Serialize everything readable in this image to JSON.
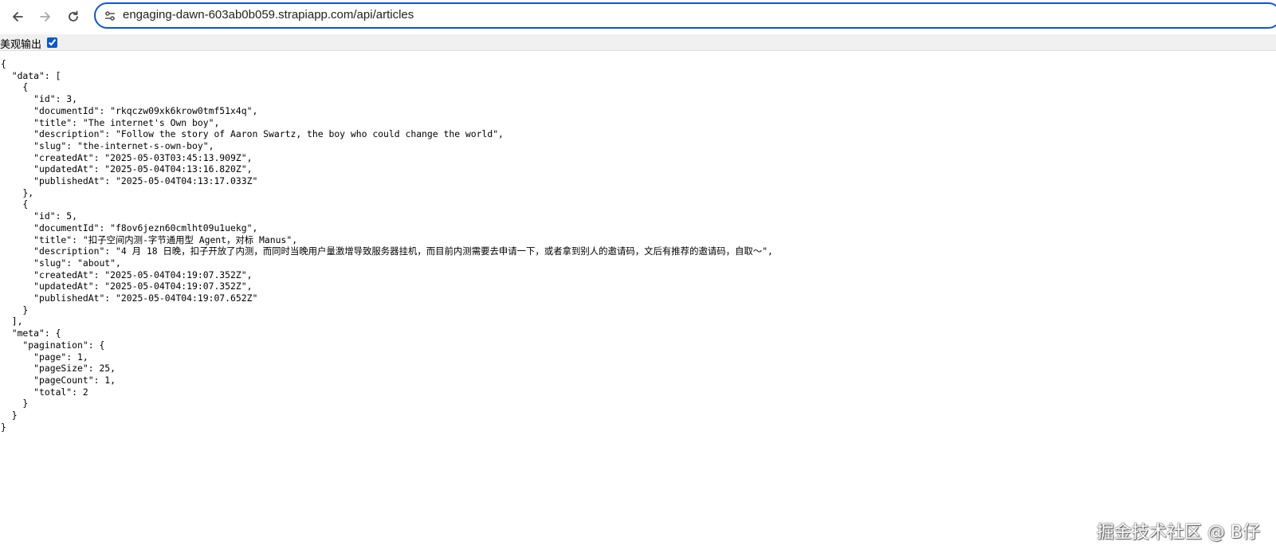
{
  "browser": {
    "url": "engaging-dawn-603ab0b059.strapiapp.com/api/articles"
  },
  "viewer": {
    "pretty_print_label": "美观输出",
    "pretty_print_checked": true,
    "json_text": "{\n  \"data\": [\n    {\n      \"id\": 3,\n      \"documentId\": \"rkqczw09xk6krow0tmf51x4q\",\n      \"title\": \"The internet's Own boy\",\n      \"description\": \"Follow the story of Aaron Swartz, the boy who could change the world\",\n      \"slug\": \"the-internet-s-own-boy\",\n      \"createdAt\": \"2025-05-03T03:45:13.909Z\",\n      \"updatedAt\": \"2025-05-04T04:13:16.820Z\",\n      \"publishedAt\": \"2025-05-04T04:13:17.033Z\"\n    },\n    {\n      \"id\": 5,\n      \"documentId\": \"f8ov6jezn60cmlht09u1uekg\",\n      \"title\": \"扣子空间内测-字节通用型 Agent，对标 Manus\",\n      \"description\": \"4 月 18 日晚，扣子开放了内测，而同时当晚用户量激增导致服务器挂机，而目前内测需要去申请一下，或者拿到别人的邀请码，文后有推荐的邀请码，自取～\",\n      \"slug\": \"about\",\n      \"createdAt\": \"2025-05-04T04:19:07.352Z\",\n      \"updatedAt\": \"2025-05-04T04:19:07.352Z\",\n      \"publishedAt\": \"2025-05-04T04:19:07.652Z\"\n    }\n  ],\n  \"meta\": {\n    \"pagination\": {\n      \"page\": 1,\n      \"pageSize\": 25,\n      \"pageCount\": 1,\n      \"total\": 2\n    }\n  }\n}"
  },
  "watermark": {
    "text": "掘金技术社区 @ B仔"
  },
  "icons": {
    "back": "back-arrow-icon",
    "forward": "forward-arrow-icon",
    "reload": "reload-icon",
    "site_info": "site-info-tune-icon"
  },
  "colors": {
    "omnibox_border": "#0b57d0",
    "pretty_bar_bg": "#f0f0f0"
  }
}
